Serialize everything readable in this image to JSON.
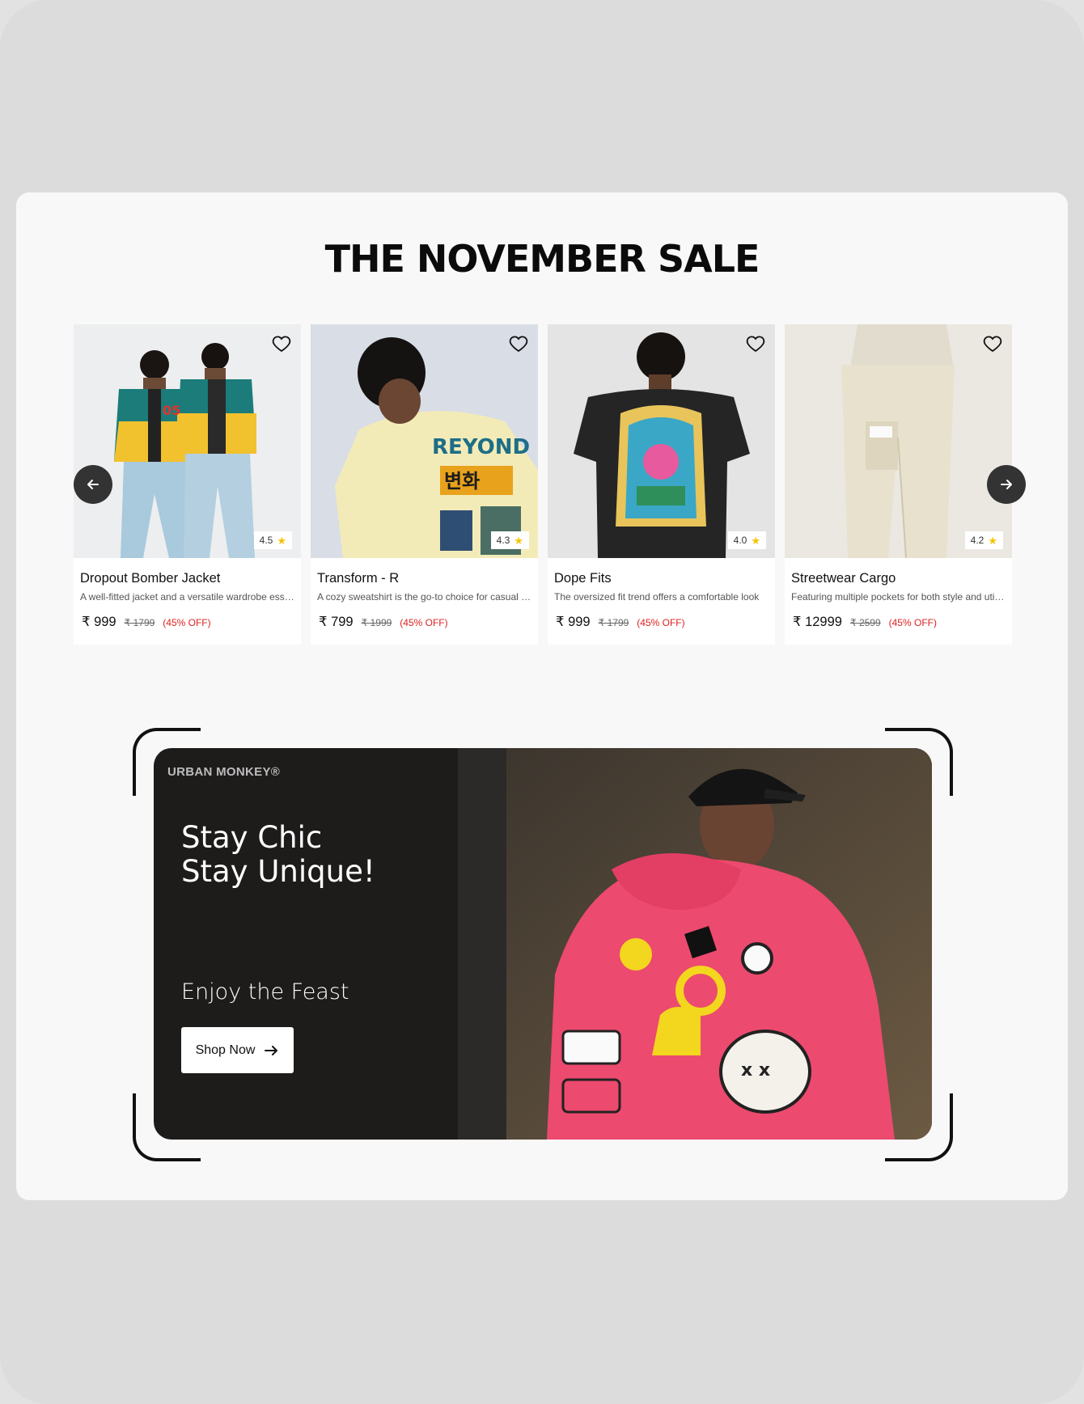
{
  "section": {
    "title": "THE NOVEMBER SALE"
  },
  "products": [
    {
      "name": "Dropout Bomber Jacket",
      "description": "A well-fitted jacket and a versatile wardrobe essential",
      "price": "₹ 999",
      "mrp": "₹ 1799",
      "discount": "(45% OFF)",
      "rating": "4.5"
    },
    {
      "name": "Transform - R",
      "description": "A cozy sweatshirt is the go-to choice for casual comfort",
      "price": "₹ 799",
      "mrp": "₹ 1999",
      "discount": "(45% OFF)",
      "rating": "4.3"
    },
    {
      "name": "Dope Fits",
      "description": "The oversized fit trend offers a comfortable look",
      "price": "₹ 999",
      "mrp": "₹ 1799",
      "discount": "(45% OFF)",
      "rating": "4.0"
    },
    {
      "name": "Streetwear Cargo",
      "description": "Featuring multiple pockets for both style and utility",
      "price": "₹ 12999",
      "mrp": "₹ 2599",
      "discount": "(45% OFF)",
      "rating": "4.2"
    }
  ],
  "banner": {
    "brand": "URBAN MONKEY®",
    "headline_line1": "Stay Chic",
    "headline_line2": "Stay Unique!",
    "subtext": "Enjoy the Feast",
    "cta_label": "Shop Now"
  },
  "icons": {
    "wishlist": "heart-icon",
    "rating": "star-icon",
    "prev": "arrow-left-icon",
    "next": "arrow-right-icon",
    "cta": "arrow-right-icon"
  },
  "colors": {
    "discount": "#e02020",
    "star": "#f5c400",
    "banner_bg": "#1e1c1b",
    "nav_button": "#333333"
  }
}
